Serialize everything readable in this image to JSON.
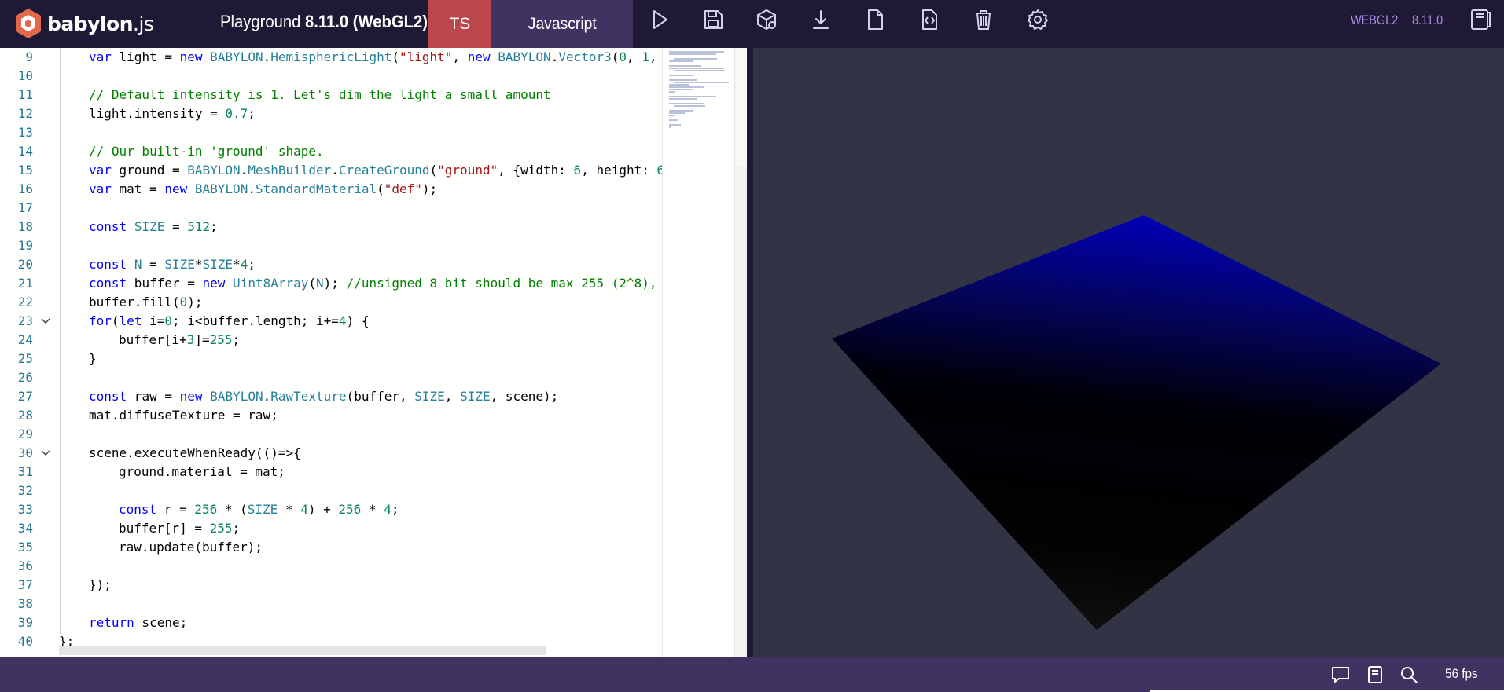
{
  "header": {
    "logo_text": "babylon",
    "logo_suffix": ".js",
    "title_prefix": "Playground ",
    "title_version": "8.11.0 (WebGL2)",
    "tab_ts": "TS",
    "tab_js": "Javascript",
    "icons": [
      "play-icon",
      "save-icon",
      "inspector-icon",
      "download-icon",
      "new-icon",
      "clear-icon",
      "delete-icon",
      "settings-icon"
    ],
    "engine_label": "WEBGL2",
    "version_label": "8.11.0",
    "colors": {
      "bar": "#201936",
      "ts_tab": "#bb464b",
      "js_tab": "#3f3461",
      "accent": "#a78ee8"
    }
  },
  "editor": {
    "lines": [
      {
        "n": "9"
      },
      {
        "n": "10"
      },
      {
        "n": "11"
      },
      {
        "n": "12"
      },
      {
        "n": "13"
      },
      {
        "n": "14"
      },
      {
        "n": "15"
      },
      {
        "n": "16"
      },
      {
        "n": "17"
      },
      {
        "n": "18"
      },
      {
        "n": "19"
      },
      {
        "n": "20"
      },
      {
        "n": "21"
      },
      {
        "n": "22"
      },
      {
        "n": "23",
        "fold": true
      },
      {
        "n": "24"
      },
      {
        "n": "25"
      },
      {
        "n": "26"
      },
      {
        "n": "27"
      },
      {
        "n": "28"
      },
      {
        "n": "29"
      },
      {
        "n": "30",
        "fold": true
      },
      {
        "n": "31"
      },
      {
        "n": "32"
      },
      {
        "n": "33"
      },
      {
        "n": "34"
      },
      {
        "n": "35"
      },
      {
        "n": "36"
      },
      {
        "n": "37"
      },
      {
        "n": "38"
      },
      {
        "n": "39"
      },
      {
        "n": "40"
      }
    ],
    "code": {
      "l9_a": "var",
      "l9_b": " light = ",
      "l9_c": "new",
      "l9_d": "BABYLON",
      "l9_e": ".",
      "l9_f": "HemisphericLight",
      "l9_g": "(",
      "l9_h": "\"light\"",
      "l9_i": ", ",
      "l9_j": "new",
      "l9_k": "BABYLON",
      "l9_l": ".",
      "l9_m": "Vector3",
      "l9_n": "(",
      "l9_o": "0",
      "l9_p": ", ",
      "l9_q": "1",
      "l9_r": ",",
      "l11": "// Default intensity is 1. Let's dim the light a small amount",
      "l12_a": "light.intensity = ",
      "l12_b": "0.7",
      "l12_c": ";",
      "l14": "// Our built-in 'ground' shape.",
      "l15_a": "var",
      "l15_b": " ground = ",
      "l15_c": "BABYLON",
      "l15_d": ".",
      "l15_e": "MeshBuilder",
      "l15_f": ".",
      "l15_g": "CreateGround",
      "l15_h": "(",
      "l15_i": "\"ground\"",
      "l15_j": ", {width: ",
      "l15_k": "6",
      "l15_l": ", height: ",
      "l15_m": "6",
      "l16_a": "var",
      "l16_b": " mat = ",
      "l16_c": "new",
      "l16_d": "BABYLON",
      "l16_e": ".",
      "l16_f": "StandardMaterial",
      "l16_g": "(",
      "l16_h": "\"def\"",
      "l16_i": ");",
      "l18_a": "const",
      "l18_b": " ",
      "l18_c": "SIZE",
      "l18_d": " = ",
      "l18_e": "512",
      "l18_f": ";",
      "l20_a": "const",
      "l20_b": " ",
      "l20_c": "N",
      "l20_d": " = ",
      "l20_e": "SIZE",
      "l20_f": "*",
      "l20_g": "SIZE",
      "l20_h": "*",
      "l20_i": "4",
      "l20_j": ";",
      "l21_a": "const",
      "l21_b": " buffer = ",
      "l21_c": "new",
      "l21_d": "Uint8Array",
      "l21_e": "(",
      "l21_f": "N",
      "l21_g": "); ",
      "l21_h": "//unsigned 8 bit should be max 255 (2^8),",
      "l22_a": "buffer.fill(",
      "l22_b": "0",
      "l22_c": ");",
      "l23_a": "for",
      "l23_b": "(",
      "l23_c": "let",
      "l23_d": " i=",
      "l23_e": "0",
      "l23_f": "; i<buffer.length; i+=",
      "l23_g": "4",
      "l23_h": ") {",
      "l24_a": "buffer[i+",
      "l24_b": "3",
      "l24_c": "]=",
      "l24_d": "255",
      "l24_e": ";",
      "l25": "}",
      "l27_a": "const",
      "l27_b": " raw = ",
      "l27_c": "new",
      "l27_d": "BABYLON",
      "l27_e": ".",
      "l27_f": "RawTexture",
      "l27_g": "(buffer, ",
      "l27_h": "SIZE",
      "l27_i": ", ",
      "l27_j": "SIZE",
      "l27_k": ", scene);",
      "l28": "mat.diffuseTexture = raw;",
      "l30": "scene.executeWhenReady(()=>{",
      "l31": "ground.material = mat;",
      "l33_a": "const",
      "l33_b": " r = ",
      "l33_c": "256",
      "l33_d": " * (",
      "l33_e": "SIZE",
      "l33_f": " * ",
      "l33_g": "4",
      "l33_h": ") + ",
      "l33_i": "256",
      "l33_j": " * ",
      "l33_k": "4",
      "l33_l": ";",
      "l34_a": "buffer[r] = ",
      "l34_b": "255",
      "l34_c": ";",
      "l35": "raw.update(buffer);",
      "l37": "});",
      "l39_a": "return",
      "l39_b": " scene;",
      "l40": "};"
    }
  },
  "footer": {
    "icons": [
      "chat-icon",
      "notebook-icon",
      "search-icon"
    ],
    "fps": "56 fps"
  }
}
